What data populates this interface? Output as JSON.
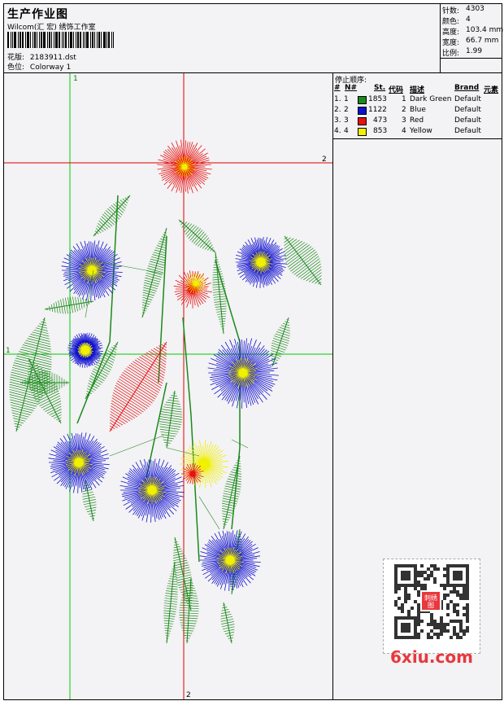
{
  "header": {
    "title": "生产作业图",
    "studio": "Wilcom(汇 宏) 绣饰工作室",
    "design_label": "花版:",
    "design_value": "2183911.dst",
    "colorway_label": "色位:",
    "colorway_value": "Colorway 1"
  },
  "stats": [
    {
      "label": "针数:",
      "value": "4303"
    },
    {
      "label": "颜色:",
      "value": "4"
    },
    {
      "label": "高度:",
      "value": "103.4 mm"
    },
    {
      "label": "宽度:",
      "value": "66.7 mm"
    },
    {
      "label": "比例:",
      "value": "1.99"
    }
  ],
  "stop_sequence": {
    "title": "停止顺序:",
    "headers": [
      "#",
      "N#",
      "St.",
      "代码",
      "描述",
      "Brand",
      "元素"
    ],
    "rows": [
      {
        "index": "1.",
        "n": "1",
        "color": "#1a8a1a",
        "stitches": "1853",
        "code": "1",
        "desc": "Dark Green",
        "brand": "Default"
      },
      {
        "index": "2.",
        "n": "2",
        "color": "#1010d0",
        "stitches": "1122",
        "code": "2",
        "desc": "Blue",
        "brand": "Default"
      },
      {
        "index": "3.",
        "n": "3",
        "color": "#e81010",
        "stitches": "473",
        "code": "3",
        "desc": "Red",
        "brand": "Default"
      },
      {
        "index": "4.",
        "n": "4",
        "color": "#f0f000",
        "stitches": "853",
        "code": "4",
        "desc": "Yellow",
        "brand": "Default"
      }
    ]
  },
  "guides": {
    "v1_label": "1",
    "v2_label": "2",
    "h1_label": "1",
    "h2_label": "2"
  },
  "watermark": {
    "qr_center_text": "刺绣图",
    "site": "6xiu.com"
  },
  "colors": {
    "guide_green": "#00cc00",
    "guide_red": "#e00000",
    "thread_green": "#1a8a1a",
    "thread_blue": "#1010d0",
    "thread_red": "#e81010",
    "thread_yellow": "#f0f000"
  }
}
